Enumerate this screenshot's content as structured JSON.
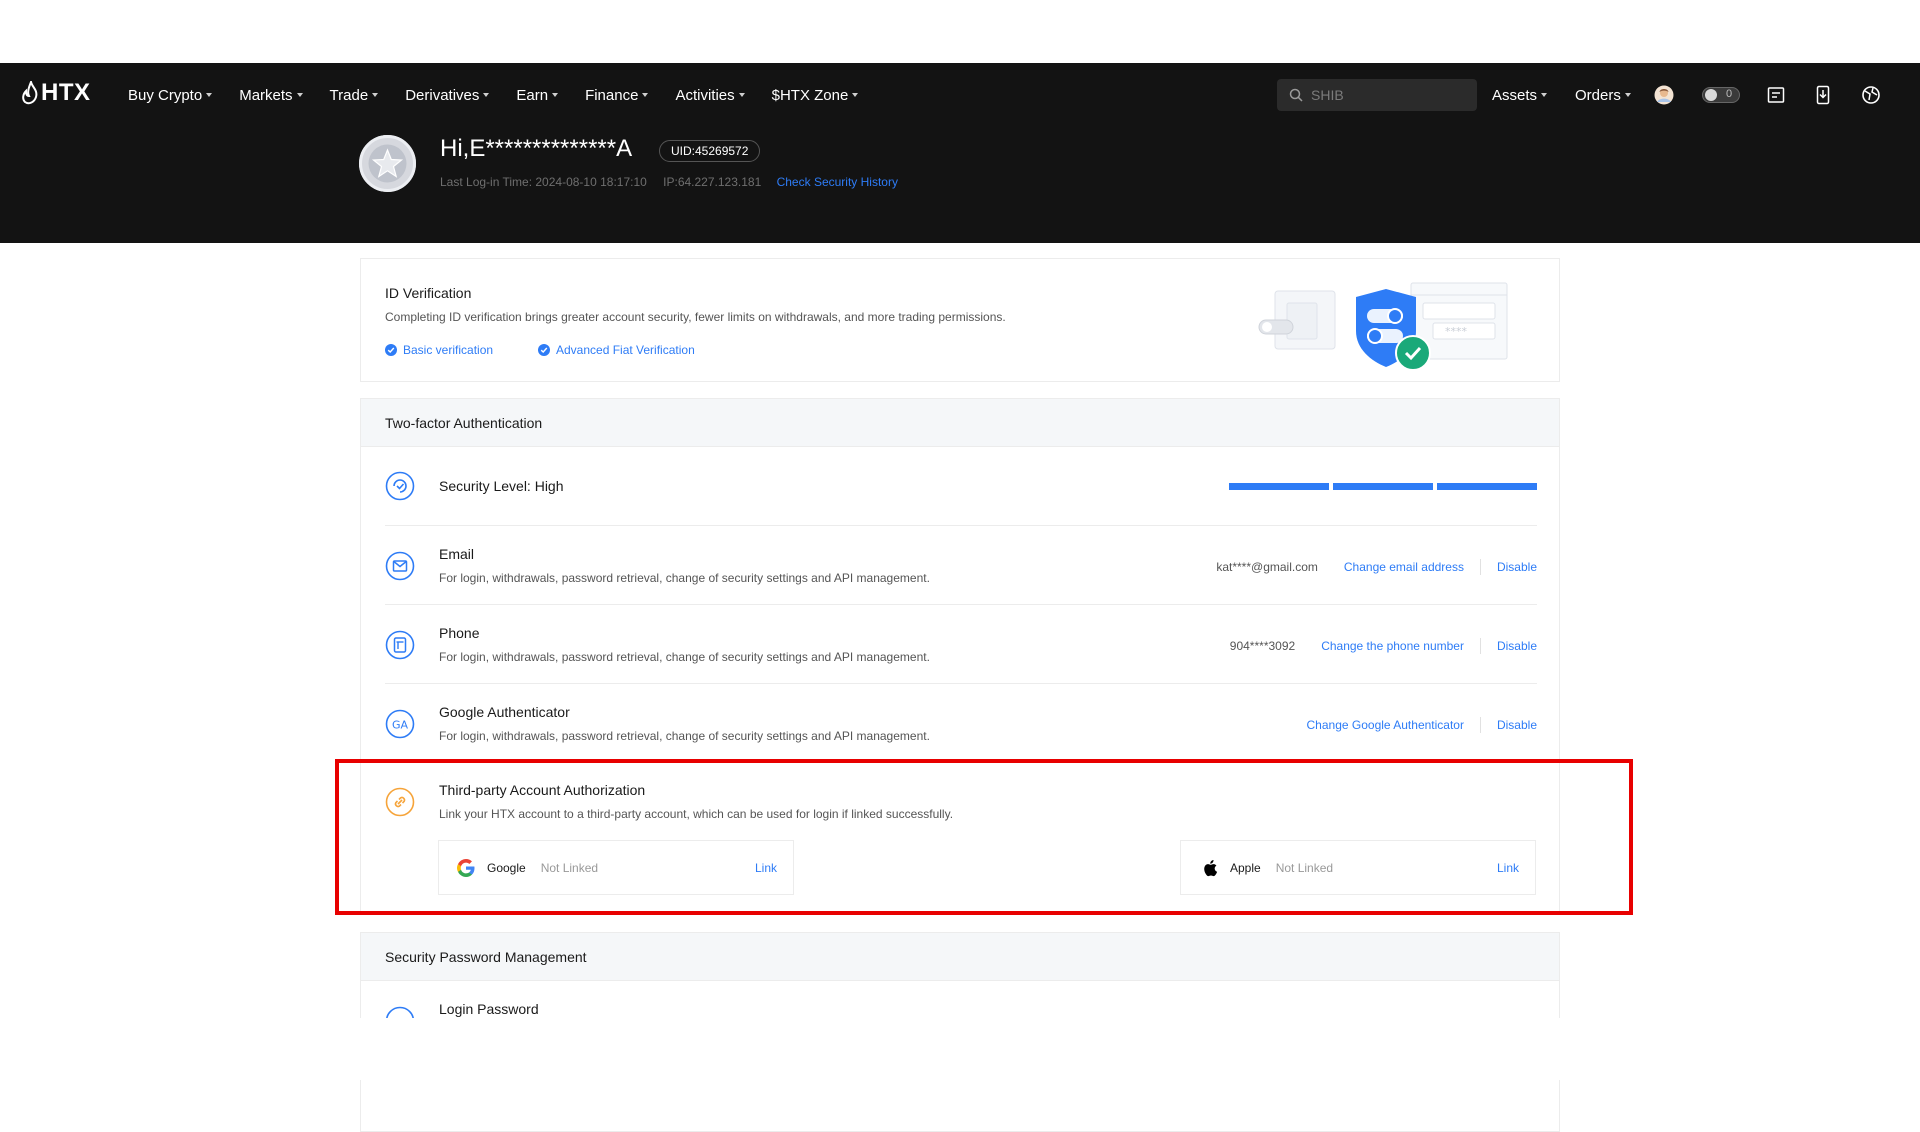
{
  "nav": {
    "logo": "HTX",
    "items": [
      {
        "label": "Buy Crypto"
      },
      {
        "label": "Markets"
      },
      {
        "label": "Trade"
      },
      {
        "label": "Derivatives"
      },
      {
        "label": "Earn"
      },
      {
        "label": "Finance"
      },
      {
        "label": "Activities"
      },
      {
        "label": "$HTX Zone"
      }
    ],
    "search_placeholder": "SHIB",
    "assets": "Assets",
    "orders": "Orders",
    "toggle_count": "0"
  },
  "profile": {
    "greeting": "Hi,E**************A",
    "uid": "UID:45269572",
    "last_login": "Last Log-in Time: 2024-08-10 18:17:10",
    "ip": "IP:64.227.123.181",
    "security_history": "Check Security History"
  },
  "id_verification": {
    "title": "ID Verification",
    "desc": "Completing ID verification brings greater account security, fewer limits on withdrawals, and more trading permissions.",
    "basic": "Basic verification",
    "advanced": "Advanced Fiat Verification"
  },
  "two_factor": {
    "title": "Two-factor Authentication",
    "level_label": "Security Level: High",
    "security_level_filled": 3,
    "email": {
      "title": "Email",
      "desc": "For login, withdrawals, password retrieval, change of security settings and API management.",
      "value": "kat****@gmail.com",
      "action": "Change email address",
      "disable": "Disable"
    },
    "phone": {
      "title": "Phone",
      "desc": "For login, withdrawals, password retrieval, change of security settings and API management.",
      "value": "904****3092",
      "action": "Change the phone number",
      "disable": "Disable"
    },
    "google_auth": {
      "title": "Google Authenticator",
      "desc": "For login, withdrawals, password retrieval, change of security settings and API management.",
      "action": "Change Google Authenticator",
      "disable": "Disable"
    },
    "third_party": {
      "title": "Third-party Account Authorization",
      "desc": "Link your HTX account to a third-party account, which can be used for login if linked successfully.",
      "google": {
        "name": "Google",
        "status": "Not Linked",
        "link": "Link"
      },
      "apple": {
        "name": "Apple",
        "status": "Not Linked",
        "link": "Link"
      }
    }
  },
  "security_password": {
    "title": "Security Password Management",
    "login_password": "Login Password"
  },
  "colors": {
    "accent": "#2e7cf6",
    "highlight": "#e80000",
    "orange": "#f6a43a",
    "header_bg": "#131313"
  }
}
